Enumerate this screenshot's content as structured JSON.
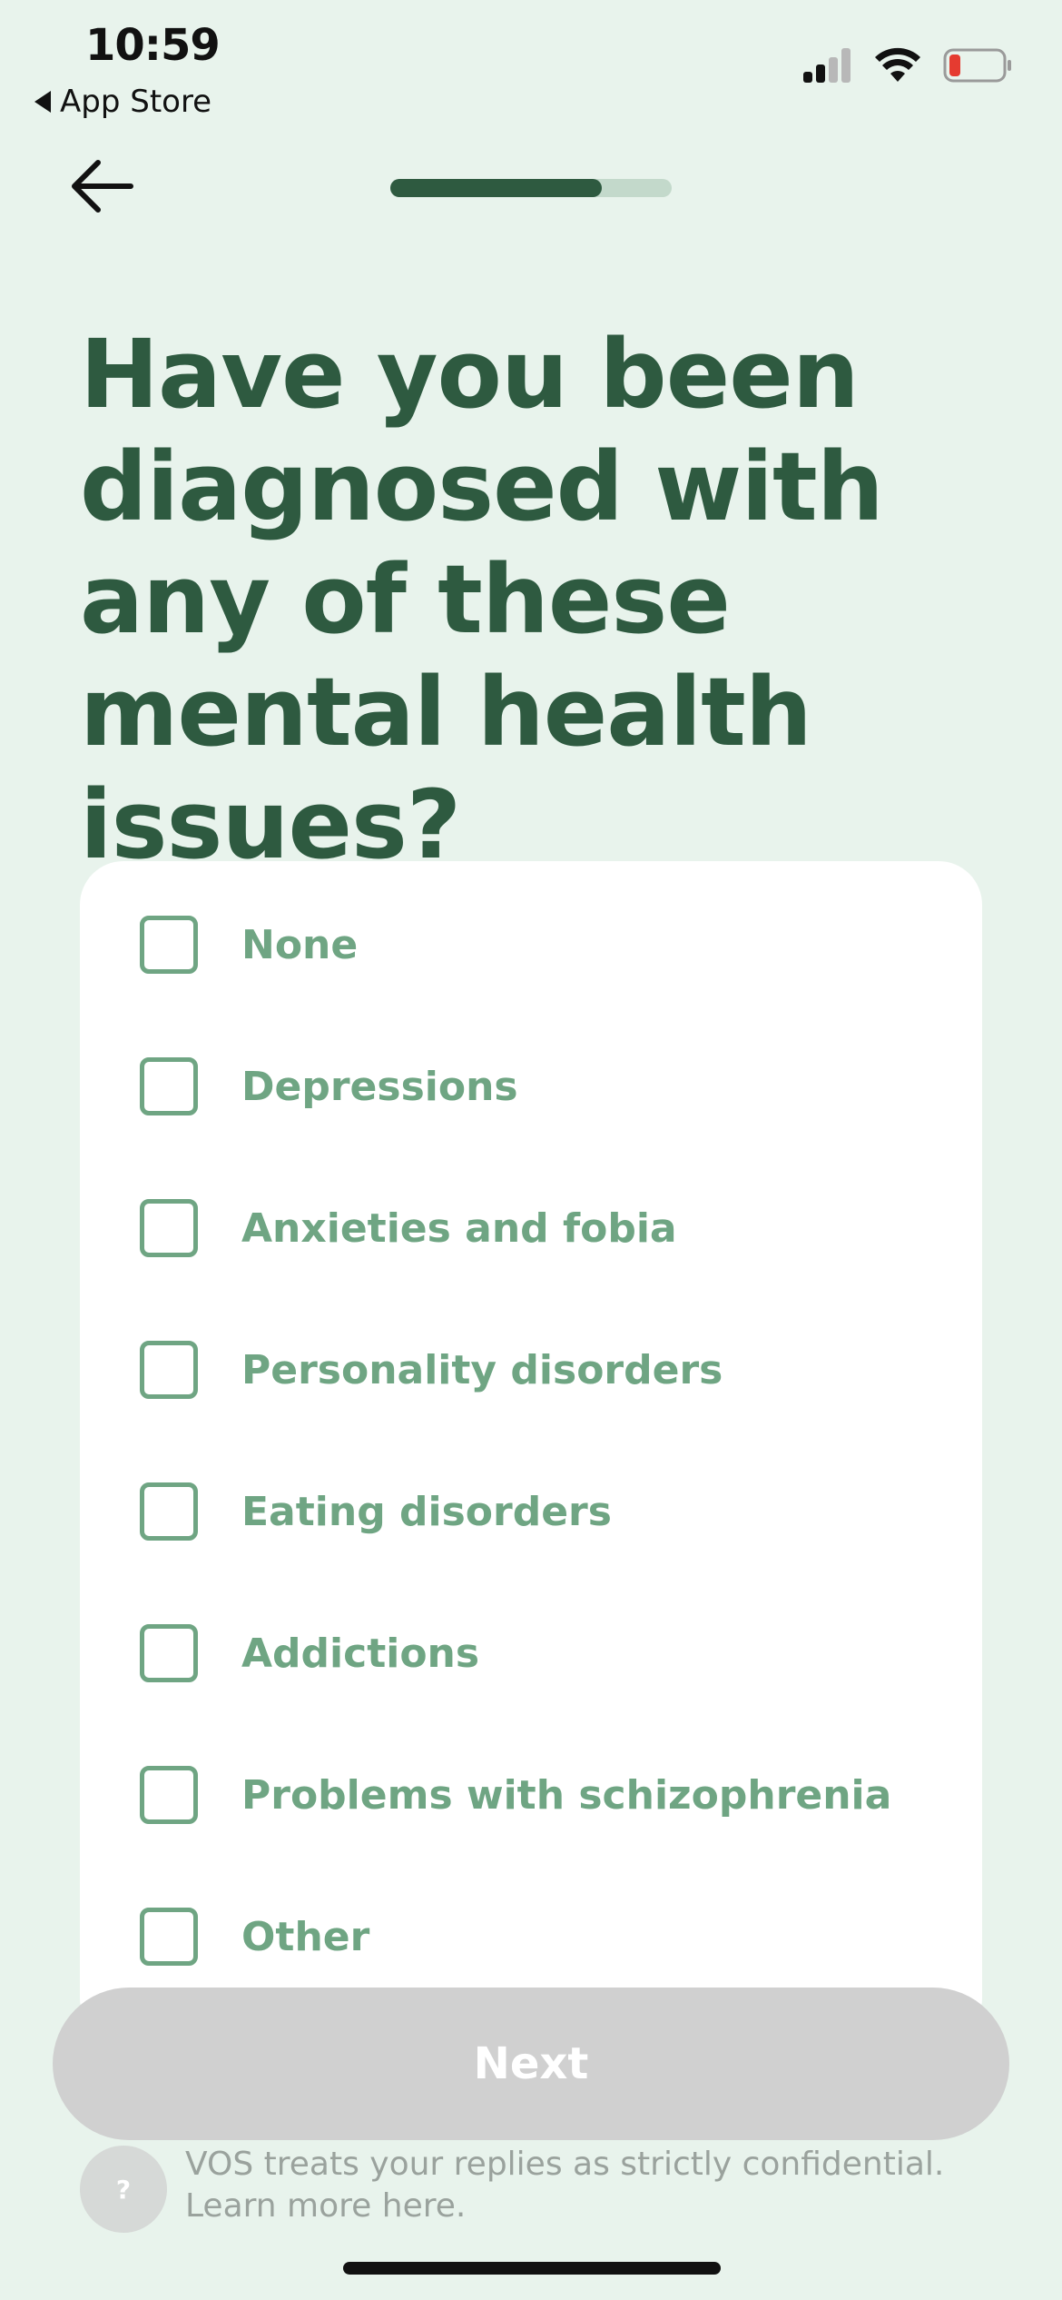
{
  "status_bar": {
    "time": "10:59",
    "back_app_label": "App Store",
    "battery_color": "#e53b30"
  },
  "header": {
    "back_icon": "arrow-left-icon",
    "progress_fraction": 0.75
  },
  "question": "Have you been diagnosed with any of these mental health issues?",
  "options": [
    {
      "label": "None",
      "checked": false
    },
    {
      "label": "Depressions",
      "checked": false
    },
    {
      "label": "Anxieties and fobia",
      "checked": false
    },
    {
      "label": "Personality disorders",
      "checked": false
    },
    {
      "label": "Eating disorders",
      "checked": false
    },
    {
      "label": "Addictions",
      "checked": false
    },
    {
      "label": "Problems with schizophrenia",
      "checked": false
    },
    {
      "label": "Other",
      "checked": false
    }
  ],
  "next_button": {
    "label": "Next",
    "enabled": false
  },
  "confidential": {
    "help_icon": "question-mark-icon",
    "help_glyph": "?",
    "text": "VOS treats your replies as strictly confidential. Learn more here."
  },
  "colors": {
    "background": "#e8f3ec",
    "primary": "#2e5a40",
    "option_text": "#6fa583",
    "disabled_button": "#d0d0d0"
  }
}
